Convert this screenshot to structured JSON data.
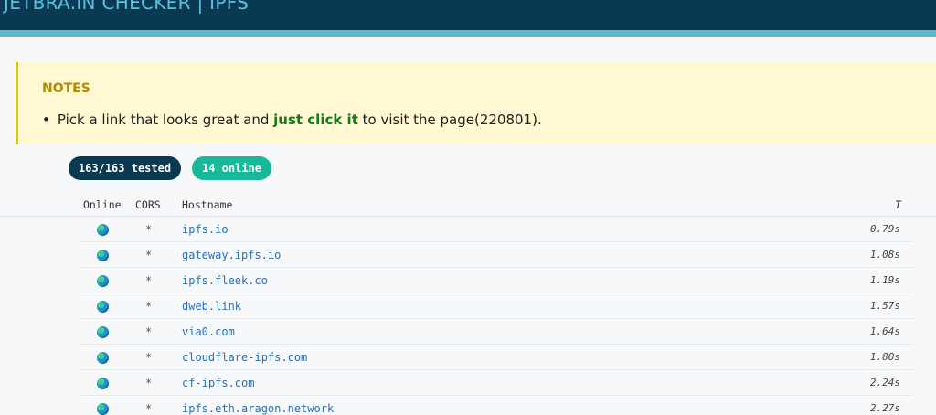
{
  "header": {
    "title": "JETBRA.IN CHECKER | IPFS"
  },
  "notes": {
    "title": "NOTES",
    "text_before": "Pick a link that looks great and ",
    "text_emphasis": "just click it",
    "text_after": " to visit the page(220801)."
  },
  "badges": {
    "tested": "163/163 tested",
    "online": "14 online"
  },
  "table": {
    "headers": {
      "online": "Online",
      "cors": "CORS",
      "hostname": "Hostname",
      "time": "T"
    },
    "rows": [
      {
        "cors": "*",
        "hostname": "ipfs.io",
        "time": "0.79s"
      },
      {
        "cors": "*",
        "hostname": "gateway.ipfs.io",
        "time": "1.08s"
      },
      {
        "cors": "*",
        "hostname": "ipfs.fleek.co",
        "time": "1.19s"
      },
      {
        "cors": "*",
        "hostname": "dweb.link",
        "time": "1.57s"
      },
      {
        "cors": "*",
        "hostname": "via0.com",
        "time": "1.64s"
      },
      {
        "cors": "*",
        "hostname": "cloudflare-ipfs.com",
        "time": "1.80s"
      },
      {
        "cors": "*",
        "hostname": "cf-ipfs.com",
        "time": "2.24s"
      },
      {
        "cors": "*",
        "hostname": "ipfs.eth.aragon.network",
        "time": "2.27s"
      }
    ]
  },
  "icons": {
    "online_status": "globe-icon"
  },
  "colors": {
    "header_bg": "#0a3a52",
    "header_text": "#5bc0de",
    "notes_bg": "#fff8d2",
    "notes_border": "#e6c200",
    "emphasis": "#1a7a1a",
    "online_badge": "#17b99a",
    "link": "#2a6fb5"
  }
}
